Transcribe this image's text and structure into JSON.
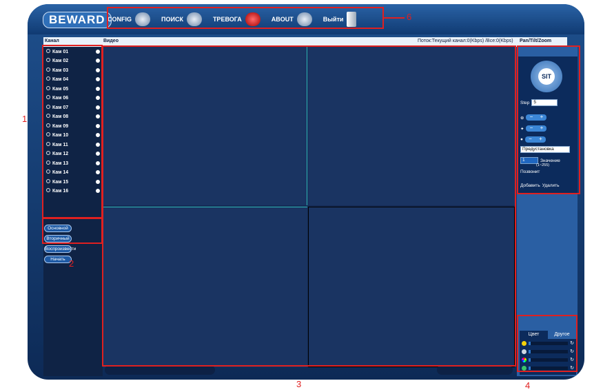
{
  "brand": {
    "logo": "BEWARD"
  },
  "menu": [
    {
      "label": "CONFIG",
      "icon": "gear-camera-icon"
    },
    {
      "label": "ПОИСК",
      "icon": "magnifier-icon"
    },
    {
      "label": "ТРЕВОГА",
      "icon": "alarm-siren-icon"
    },
    {
      "label": "ABOUT",
      "icon": "info-icon"
    },
    {
      "label": "Выйти",
      "icon": "exit-door-icon"
    }
  ],
  "headers": {
    "channel": "Канал",
    "video": "Видео",
    "stream": "Поток:Текущий канал:0(Kbps) /Все:0(Kbps)",
    "ptz": "Pan/Tilt/Zoom"
  },
  "cameras": [
    "Кам 01",
    "Кам 02",
    "Кам 03",
    "Кам 04",
    "Кам 05",
    "Кам 06",
    "Кам 07",
    "Кам 08",
    "Кам 09",
    "Кам 10",
    "Кам 11",
    "Кам 12",
    "Кам 13",
    "Кам 14",
    "Кам 15",
    "Кам 16"
  ],
  "stream_buttons": {
    "main": "Основной",
    "secondary": "Вторичный",
    "playback": "Воспроизвести",
    "start": "Начать"
  },
  "ptz": {
    "center_label": "SIT",
    "step_label": "Step",
    "step_value": "5",
    "preset_select": "Предустановка",
    "preset_value": "1",
    "value_label": "Значение",
    "value_range": "(1~255)",
    "call_label": "Позвонит",
    "add_label": "Добавить",
    "delete_label": "Удалить"
  },
  "image_tabs": {
    "color": "Цвет",
    "other": "Другое"
  },
  "annotations": {
    "a1": "1",
    "a2": "2",
    "a3": "3",
    "a4": "4",
    "a6": "6"
  },
  "colors": {
    "accent": "#2a5fa3",
    "annotation": "#e02020"
  }
}
